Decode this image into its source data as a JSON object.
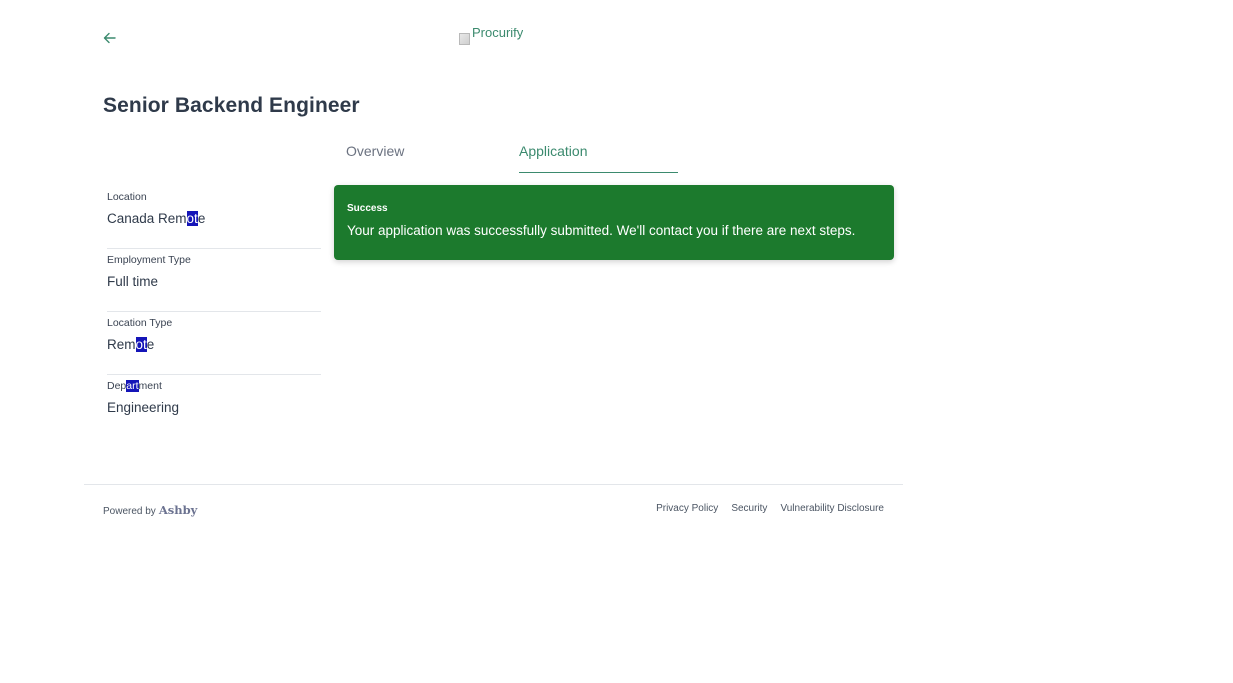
{
  "header": {
    "back_icon": "arrow-left-icon",
    "logo_alt": "Procurify",
    "accent_color": "#3b8a6e"
  },
  "job": {
    "title": "Senior Backend Engineer"
  },
  "tabs": [
    {
      "label": "Overview",
      "active": false
    },
    {
      "label": "Application",
      "active": true
    }
  ],
  "details": [
    {
      "label": "Location",
      "value_parts": [
        "Canada Rem",
        "ot",
        "e"
      ]
    },
    {
      "label": "Employment Type",
      "value": "Full time"
    },
    {
      "label": "Location Type",
      "value_parts": [
        "Rem",
        "ot",
        "e"
      ]
    },
    {
      "label_parts": [
        "Dep",
        "art",
        "ment"
      ],
      "value": "Engineering"
    }
  ],
  "toast": {
    "title": "Success",
    "message": "Your application was successfully submitted. We'll contact you if there are next steps.",
    "background_color": "#1c7a2d"
  },
  "footer": {
    "powered_by": "Powered by",
    "brand": "Ashby",
    "links": [
      "Privacy Policy",
      "Security",
      "Vulnerability Disclosure"
    ]
  }
}
